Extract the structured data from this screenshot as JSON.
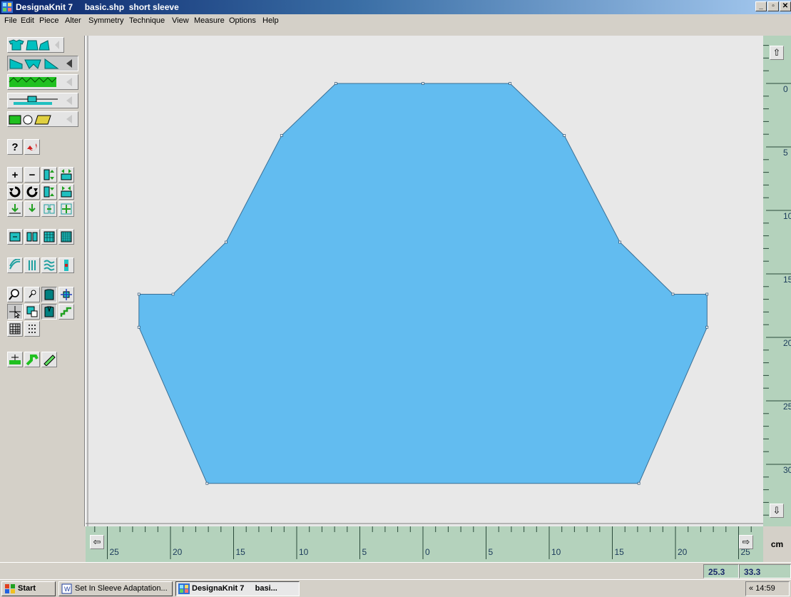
{
  "window": {
    "app_name": "DesignaKnit 7",
    "document": "basic.shp  short sleeve",
    "minimize": "_",
    "maximize": "▫",
    "close": "✕"
  },
  "menu": [
    "File",
    "Edit",
    "Piece",
    "Alter",
    "Symmetry",
    "Technique",
    "View",
    "Measure",
    "Options",
    "Help"
  ],
  "toolbar": {
    "help_label": "?",
    "zoom_in": "+",
    "zoom_out": "−"
  },
  "canvas": {
    "fill": "#62bcf0",
    "outline": "#3a6f95",
    "background": "#e8e8e8",
    "shape_points_cm": [
      [
        -6.9,
        0
      ],
      [
        0,
        0
      ],
      [
        6.9,
        0
      ],
      [
        11.2,
        4.1
      ],
      [
        15.6,
        12.5
      ],
      [
        19.8,
        16.6
      ],
      [
        22.5,
        16.6
      ],
      [
        22.5,
        19.2
      ],
      [
        17.1,
        31.5
      ],
      [
        -17.1,
        31.5
      ],
      [
        -22.5,
        19.2
      ],
      [
        -22.5,
        16.6
      ],
      [
        -19.8,
        16.6
      ],
      [
        -15.6,
        12.5
      ],
      [
        -11.2,
        4.1
      ]
    ]
  },
  "vruler": {
    "labels": [
      "0",
      "5",
      "10",
      "15",
      "20",
      "25",
      "30"
    ]
  },
  "hruler": {
    "labels": [
      "25",
      "20",
      "15",
      "10",
      "5",
      "0",
      "5",
      "10",
      "15",
      "20",
      "25"
    ]
  },
  "units": "cm",
  "status": {
    "width_value": "25.3",
    "height_value": "33.3"
  },
  "taskbar": {
    "start": "Start",
    "tasks": [
      "Set In Sleeve Adaptation...",
      "DesignaKnit 7     basi..."
    ],
    "tray_arrows": "«",
    "clock": "14:59"
  },
  "colors": {
    "title_gradient_start": "#0a246a",
    "ruler": "#b4d2bc",
    "sleeve_fill": "#62bcf0"
  }
}
